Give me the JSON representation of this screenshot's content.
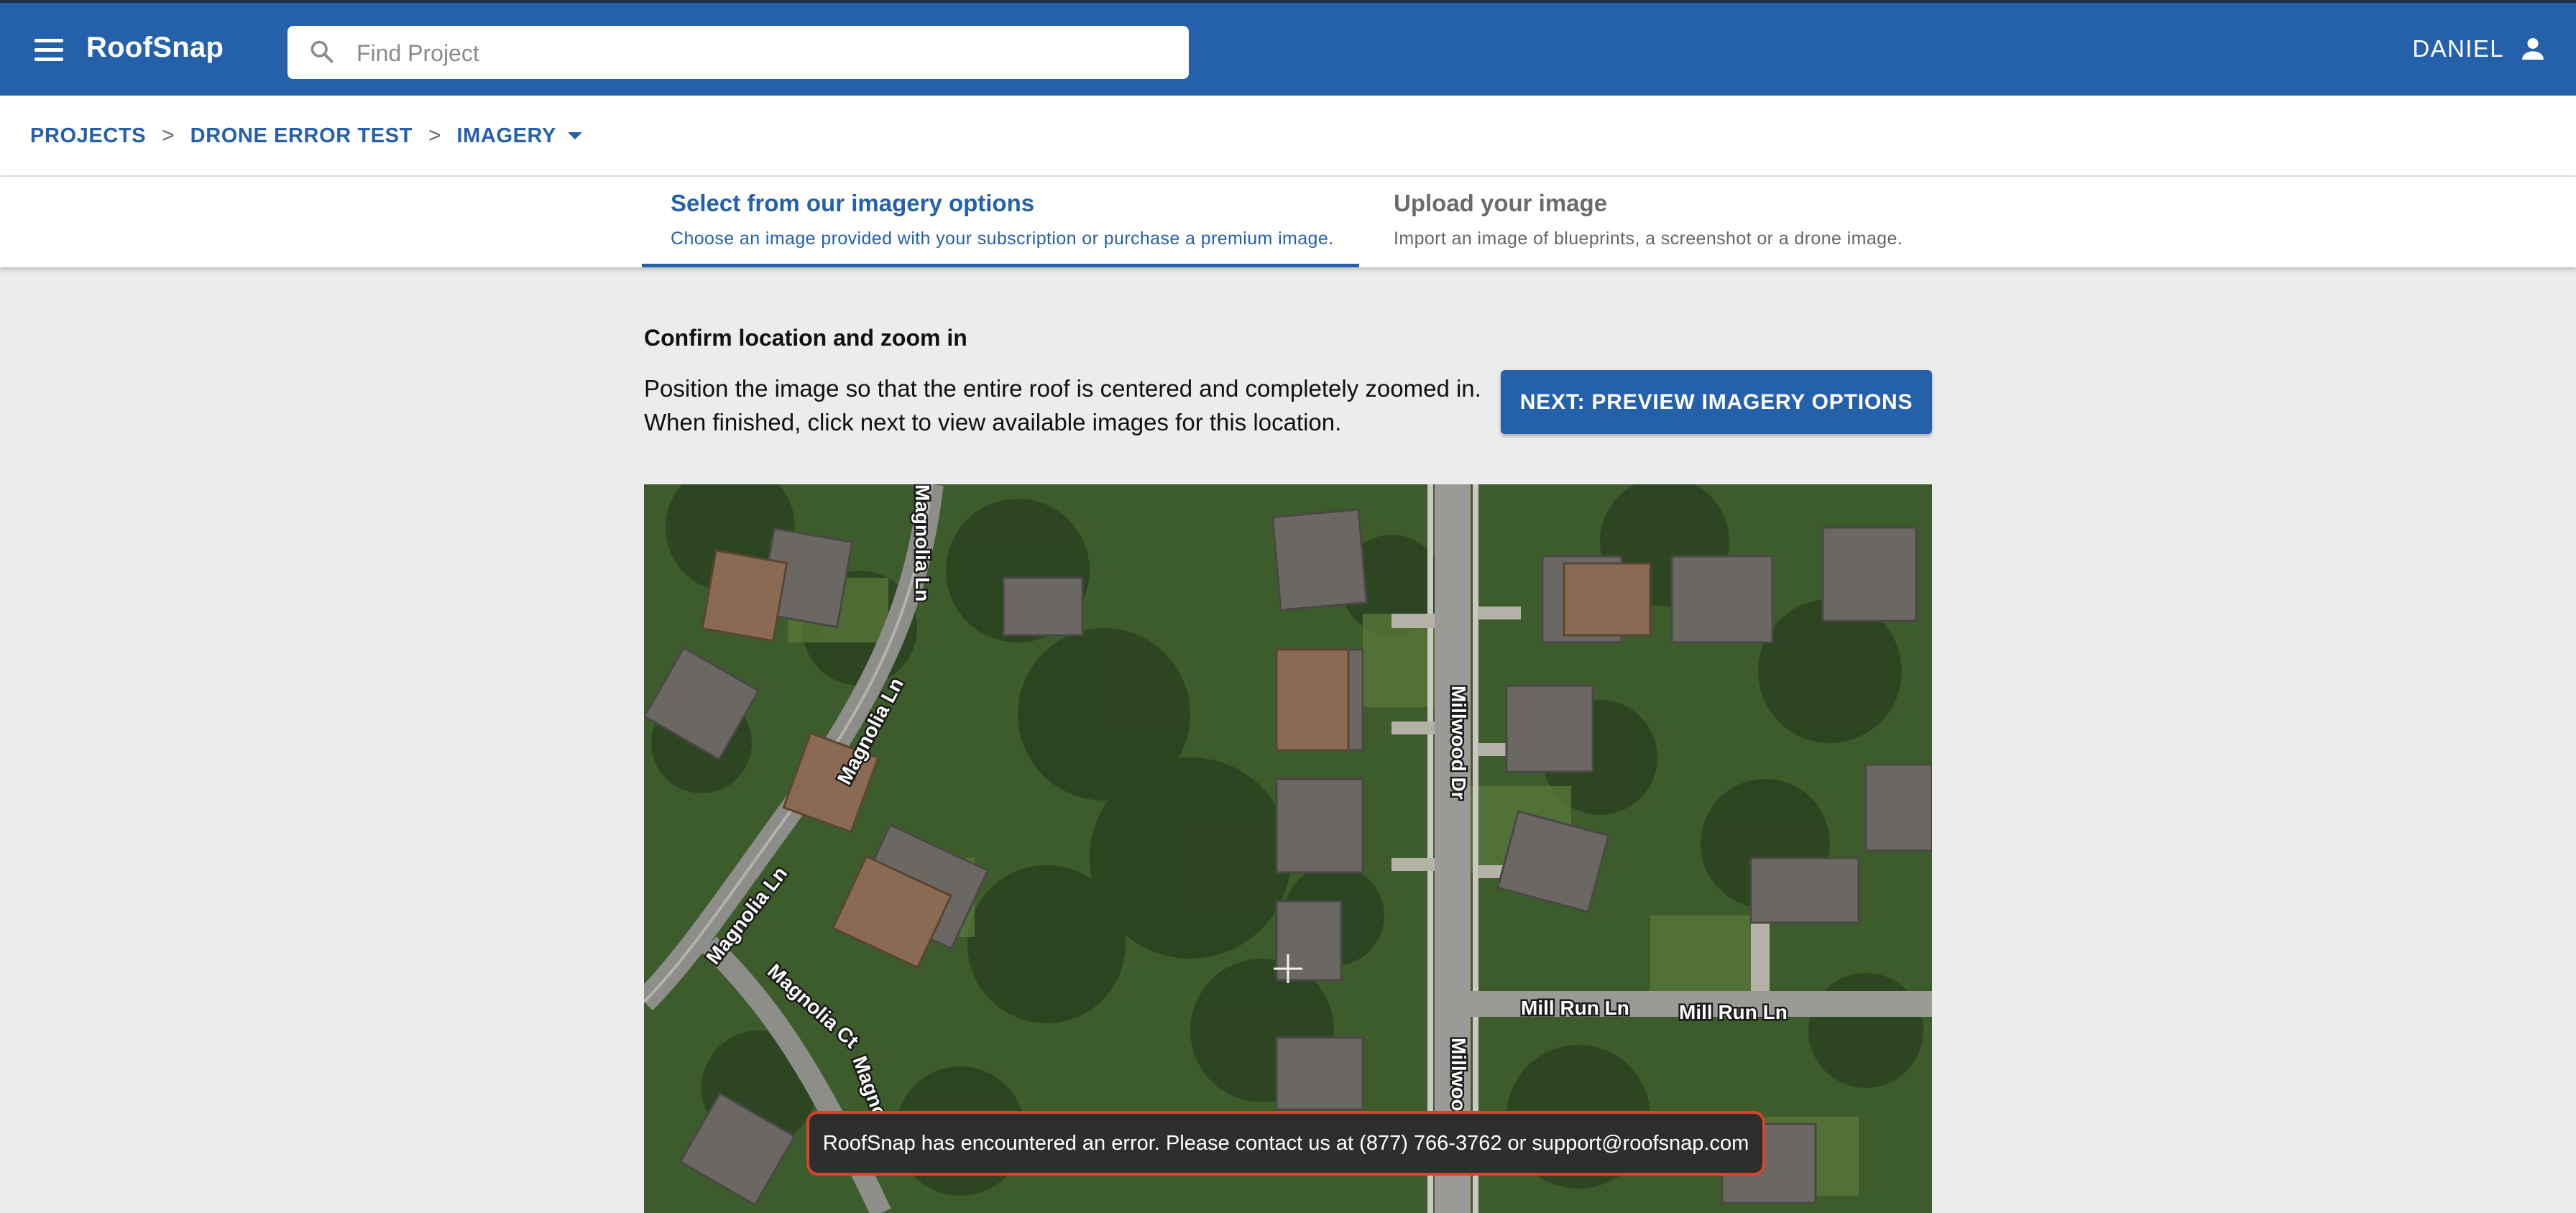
{
  "app": {
    "title": "RoofSnap"
  },
  "search": {
    "placeholder": "Find Project"
  },
  "user": {
    "name": "DANIEL"
  },
  "breadcrumb": {
    "items": [
      "PROJECTS",
      "DRONE ERROR TEST",
      "IMAGERY"
    ],
    "separator": ">"
  },
  "tabs": [
    {
      "title": "Select from our imagery options",
      "subtitle": "Choose an image provided with your subscription or purchase a premium image.",
      "active": true
    },
    {
      "title": "Upload your image",
      "subtitle": "Import an image of blueprints, a screenshot or a drone image.",
      "active": false
    }
  ],
  "content": {
    "heading": "Confirm location and zoom in",
    "instructions": "Position the image so that the entire roof is centered and completely zoomed in. When finished, click next to view available images for this location.",
    "next_button": "NEXT: PREVIEW IMAGERY OPTIONS"
  },
  "map": {
    "street_labels": [
      "Magnolia Ln",
      "Magnolia Ln",
      "Magnolia Ln",
      "Magnolia Ct",
      "Magnolia",
      "Millwood Dr",
      "Millwood Dr",
      "Mill Run Ln",
      "Mill Run Ln"
    ]
  },
  "toast": {
    "message": "RoofSnap has encountered an error. Please contact us at (877) 766-3762 or support@roofsnap.com"
  },
  "colors": {
    "brand": "#2561ab",
    "background": "#ececec",
    "toast_border": "#d9432c",
    "toast_background": "#2e2e2e"
  },
  "icons": {
    "menu": "menu-icon",
    "search": "search-icon",
    "account": "person-icon",
    "breadcrumb_dropdown": "caret-down-icon",
    "map_crosshair": "crosshair-icon"
  }
}
